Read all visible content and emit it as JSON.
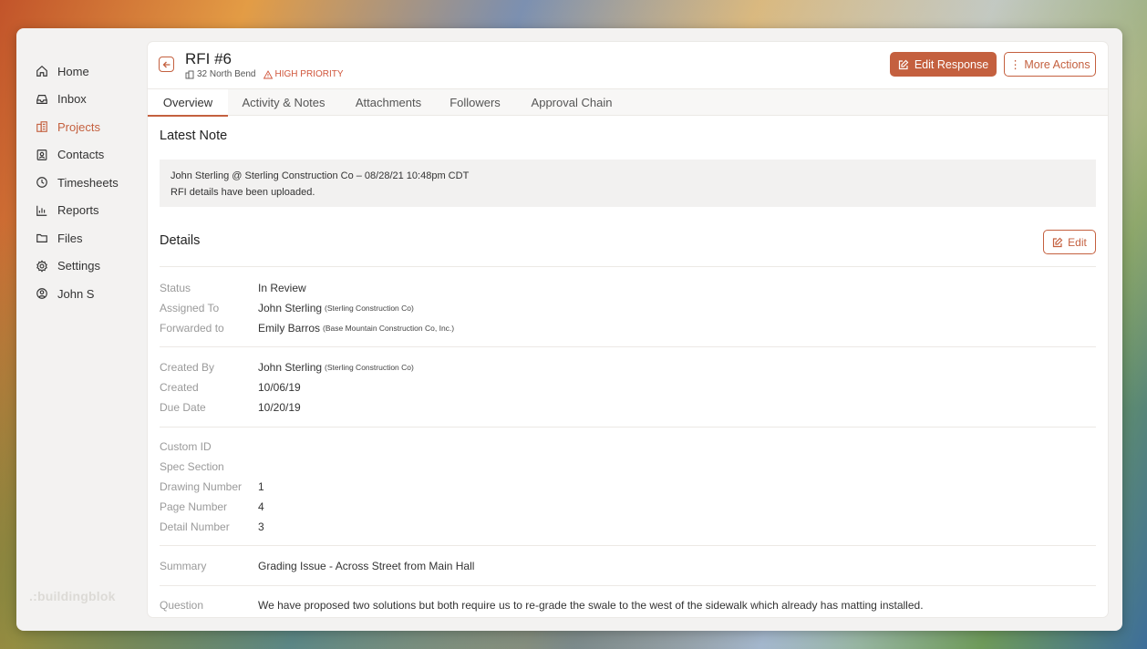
{
  "sidebar": {
    "items": [
      {
        "label": "Home",
        "icon": "home-icon"
      },
      {
        "label": "Inbox",
        "icon": "inbox-icon"
      },
      {
        "label": "Projects",
        "icon": "projects-icon",
        "active": true
      },
      {
        "label": "Contacts",
        "icon": "contacts-icon"
      },
      {
        "label": "Timesheets",
        "icon": "clock-icon"
      },
      {
        "label": "Reports",
        "icon": "reports-icon"
      },
      {
        "label": "Files",
        "icon": "folder-icon"
      },
      {
        "label": "Settings",
        "icon": "gear-icon"
      },
      {
        "label": "John S",
        "icon": "user-icon"
      }
    ],
    "brand": ".:buildingblok"
  },
  "header": {
    "title": "RFI #6",
    "project": "32 North Bend",
    "priority": "HIGH PRIORITY",
    "edit_response_label": "Edit Response",
    "more_actions_label": "⋮ More Actions"
  },
  "tabs": [
    "Overview",
    "Activity & Notes",
    "Attachments",
    "Followers",
    "Approval Chain"
  ],
  "latest_note": {
    "heading": "Latest Note",
    "author_line": "John Sterling @ Sterling Construction Co – 08/28/21 10:48pm CDT",
    "text": "RFI details have been uploaded."
  },
  "details": {
    "heading": "Details",
    "edit_label": "Edit",
    "status": {
      "label": "Status",
      "value": "In Review"
    },
    "assigned_to": {
      "label": "Assigned To",
      "value": "John Sterling",
      "org": "(Sterling Construction Co)"
    },
    "forwarded_to": {
      "label": "Forwarded to",
      "value": "Emily Barros",
      "org": "(Base Mountain Construction Co, Inc.)"
    },
    "created_by": {
      "label": "Created By",
      "value": "John Sterling",
      "org": "(Sterling Construction Co)"
    },
    "created": {
      "label": "Created",
      "value": "10/06/19"
    },
    "due_date": {
      "label": "Due Date",
      "value": "10/20/19"
    },
    "custom_id": {
      "label": "Custom ID",
      "value": ""
    },
    "spec_section": {
      "label": "Spec Section",
      "value": ""
    },
    "drawing_number": {
      "label": "Drawing Number",
      "value": "1"
    },
    "page_number": {
      "label": "Page Number",
      "value": "4"
    },
    "detail_number": {
      "label": "Detail Number",
      "value": "3"
    },
    "summary": {
      "label": "Summary",
      "value": "Grading Issue - Across Street from Main Hall"
    },
    "question": {
      "label": "Question",
      "value": "We have proposed two solutions but both require us to re-grade the swale to the west of the sidewalk which already has matting installed."
    }
  },
  "colors": {
    "accent": "#c4603f",
    "label": "#9a9a9a"
  }
}
